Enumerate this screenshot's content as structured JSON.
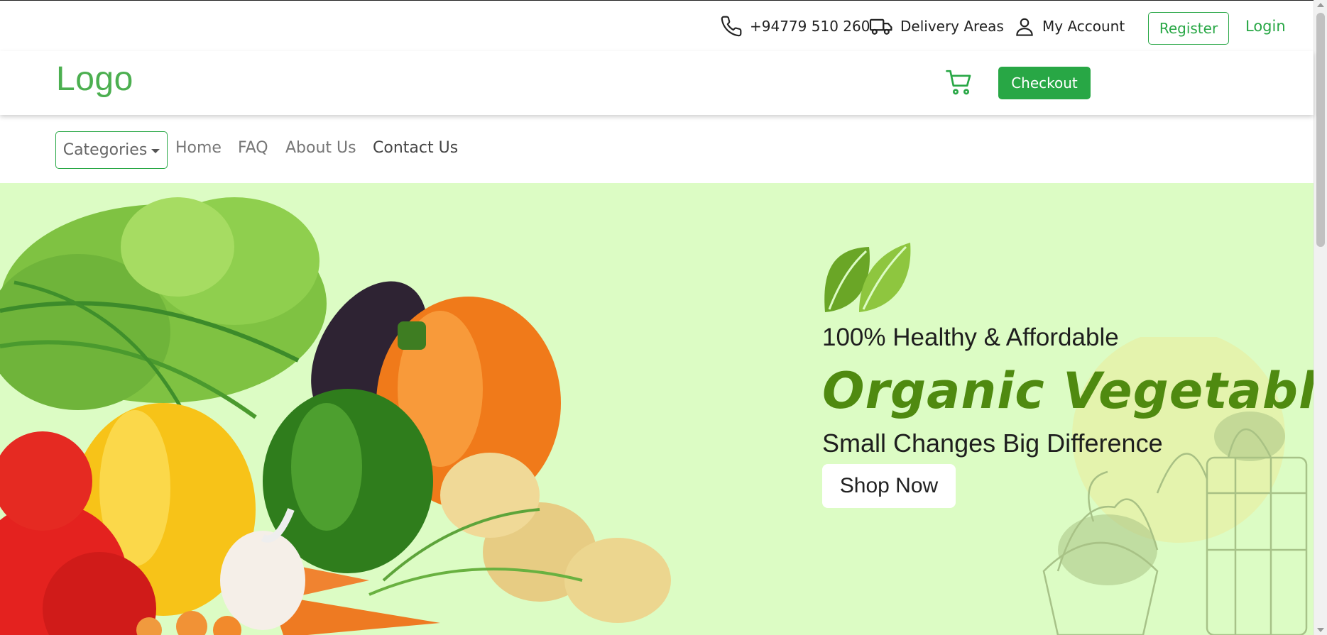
{
  "topbar": {
    "phone": "+94779 510 260",
    "delivery": "Delivery Areas",
    "account": "My Account",
    "register": "Register",
    "login": "Login"
  },
  "header": {
    "logo": "Logo",
    "checkout": "Checkout"
  },
  "nav": {
    "categories": "Categories",
    "links": [
      "Home",
      "FAQ",
      "About Us",
      "Contact Us"
    ]
  },
  "hero": {
    "tagline": "100% Healthy & Affordable",
    "title": "Organic Vegetables",
    "subtitle": "Small Changes Big Difference",
    "cta": "Shop Now"
  },
  "colors": {
    "brand_green": "#28a745",
    "logo_green": "#4caf50",
    "hero_bg": "#dcfcc4",
    "title_green": "#4f8a10"
  },
  "icons": [
    "phone-icon",
    "truck-icon",
    "user-icon",
    "cart-icon",
    "leaf-icon",
    "caret-down-icon"
  ]
}
